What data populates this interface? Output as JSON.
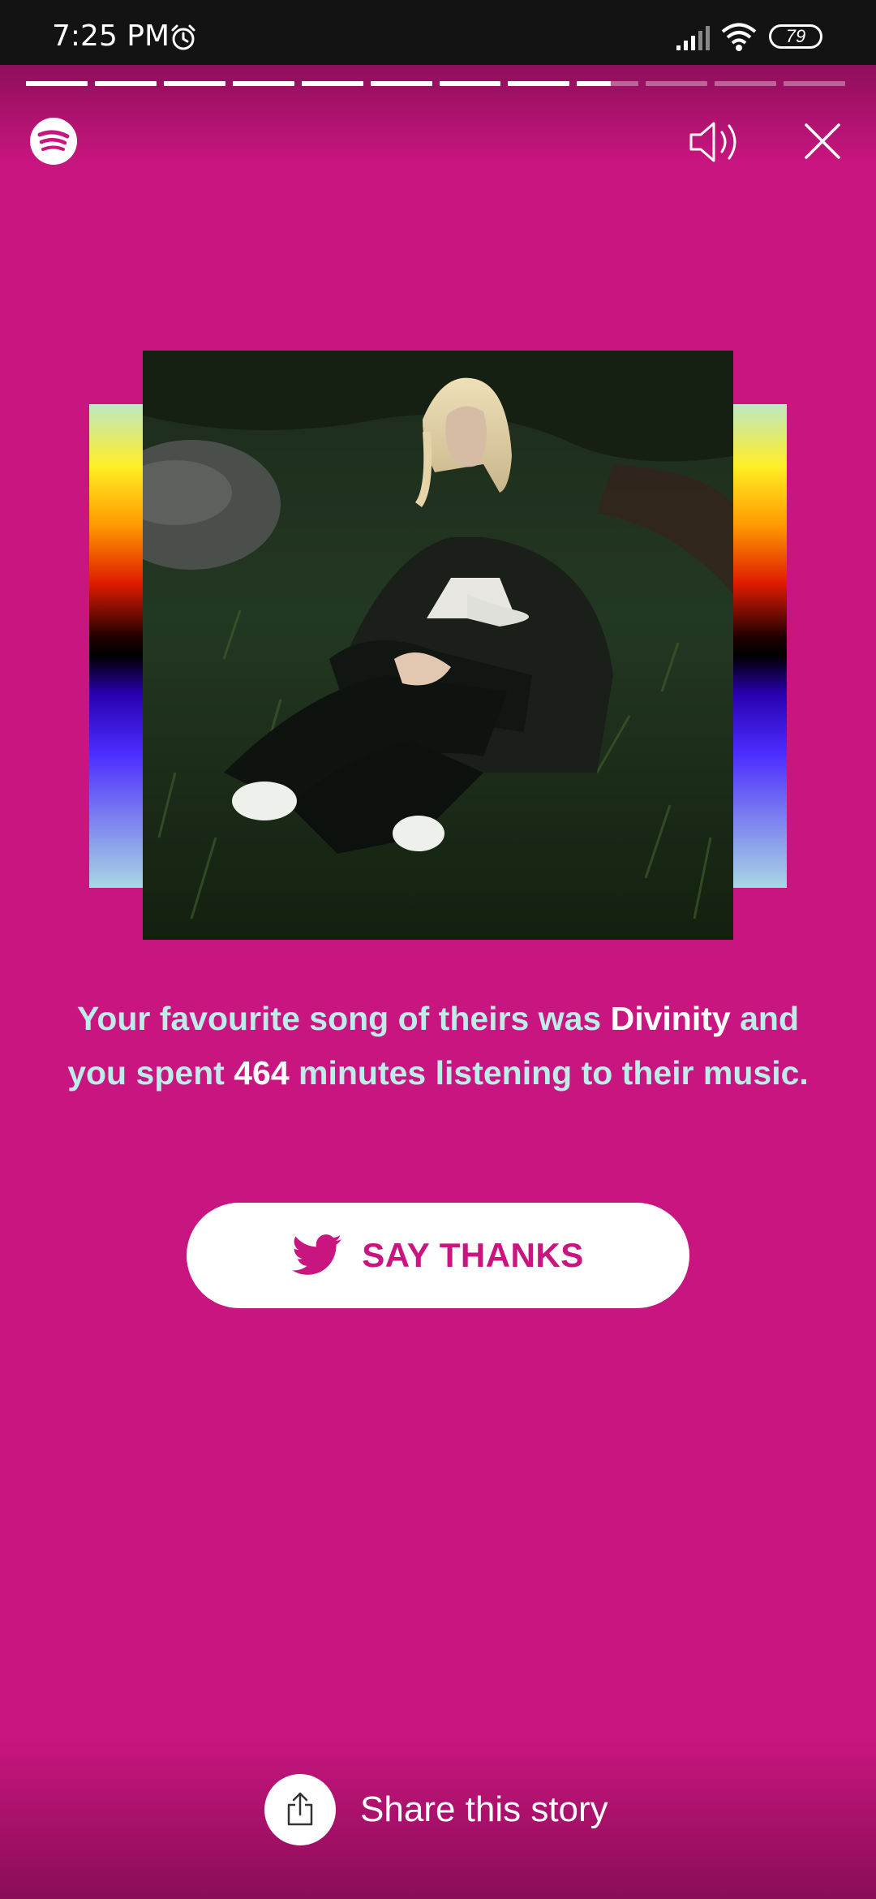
{
  "status_bar": {
    "time": "7:25 PM",
    "battery": "79"
  },
  "story": {
    "segments_total": 12,
    "segments_completed": 8,
    "current_segment_progress": 0.55
  },
  "caption": {
    "part1": "Your favourite song of theirs was ",
    "song": "Divinity",
    "part2": " and you spent ",
    "minutes": "464",
    "part3": " minutes listening to their music."
  },
  "say_thanks_label": "SAY THANKS",
  "share_label": "Share this story",
  "colors": {
    "background": "#c9157f",
    "caption": "#bdece9",
    "button_text": "#c9157f"
  },
  "icons": [
    "alarm-icon",
    "signal-icon",
    "wifi-icon",
    "spotify-logo-icon",
    "volume-icon",
    "close-icon",
    "twitter-icon",
    "share-icon"
  ]
}
